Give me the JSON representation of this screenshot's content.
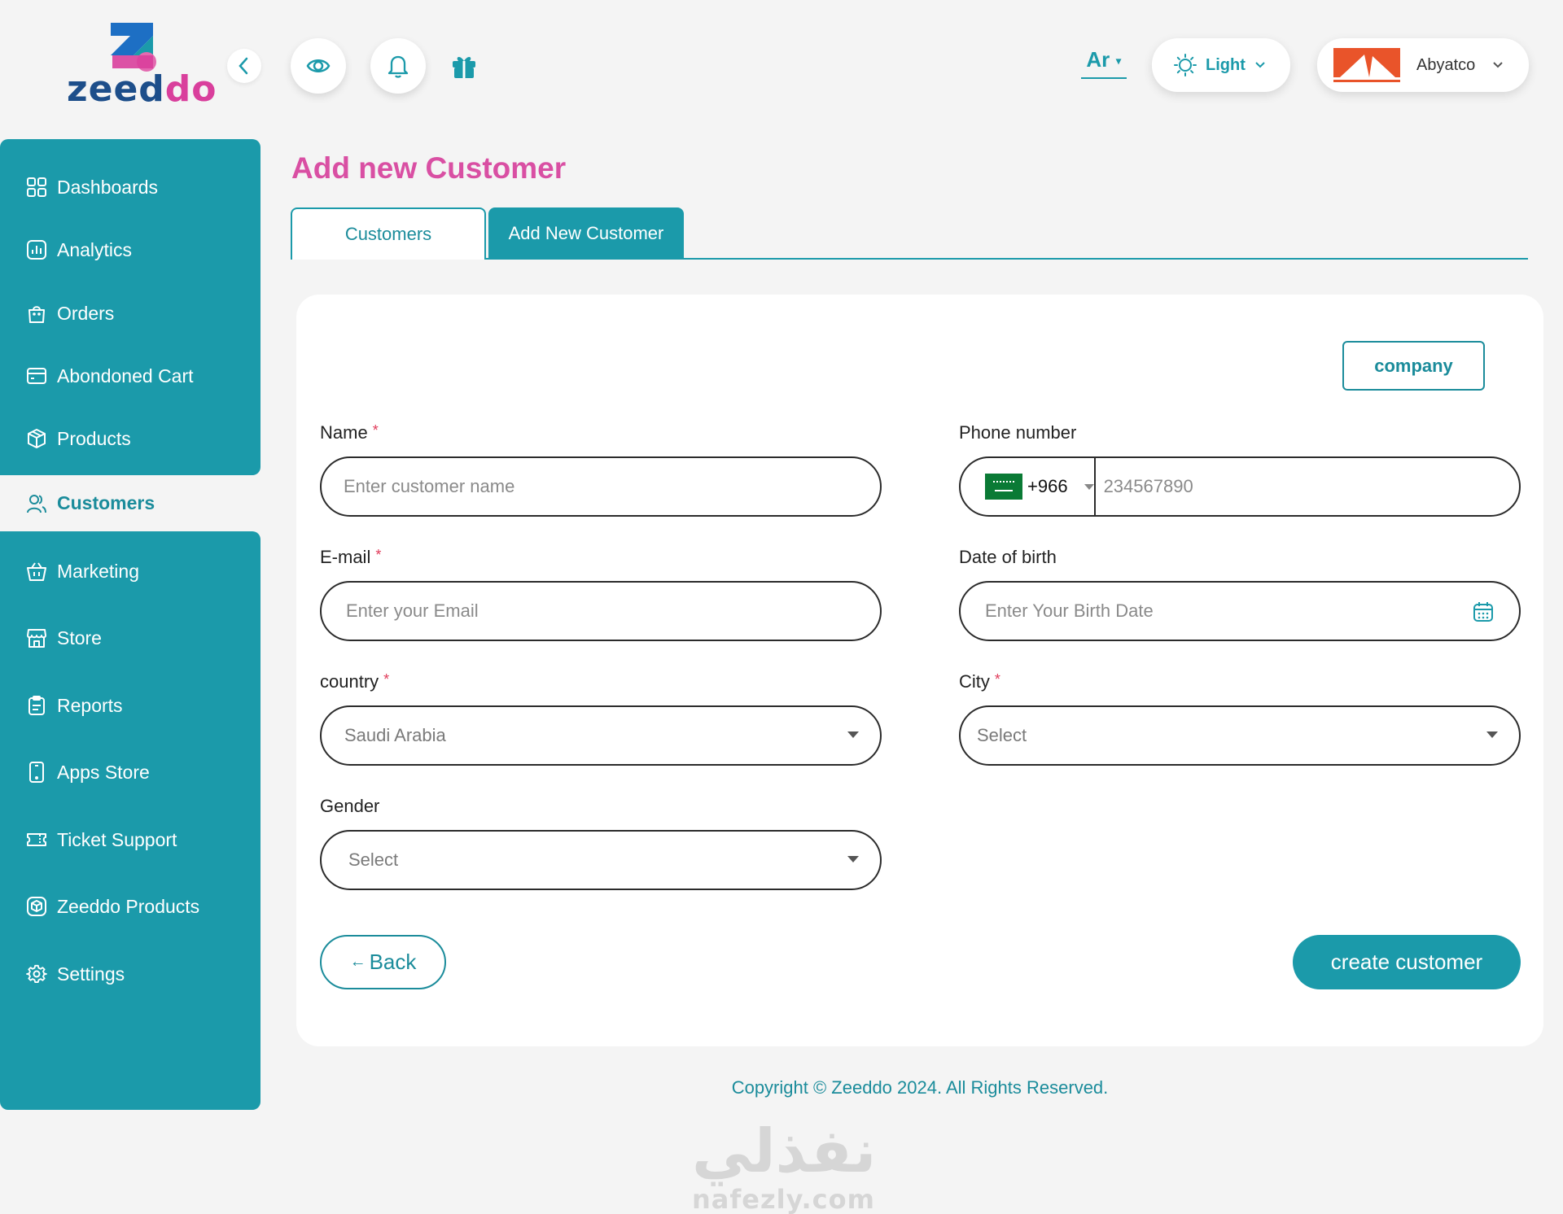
{
  "brand": {
    "name_part1": "zeed",
    "name_part2": "do"
  },
  "header": {
    "language": "Ar",
    "theme": "Light",
    "account": "Abyatco"
  },
  "sidebar": {
    "items": [
      {
        "label": "Dashboards",
        "icon": "grid-icon"
      },
      {
        "label": "Analytics",
        "icon": "analytics-icon"
      },
      {
        "label": "Orders",
        "icon": "bag-icon"
      },
      {
        "label": "Abondoned Cart",
        "icon": "cart-card-icon"
      },
      {
        "label": "Products",
        "icon": "box-icon"
      },
      {
        "label": "Customers",
        "icon": "users-icon",
        "active": true
      },
      {
        "label": "Marketing",
        "icon": "basket-icon"
      },
      {
        "label": "Store",
        "icon": "store-icon"
      },
      {
        "label": "Reports",
        "icon": "clipboard-icon"
      },
      {
        "label": "Apps Store",
        "icon": "phone-icon"
      },
      {
        "label": "Ticket Support",
        "icon": "ticket-icon"
      },
      {
        "label": "Zeeddo Products",
        "icon": "cube-icon"
      },
      {
        "label": "Settings",
        "icon": "gear-icon"
      }
    ]
  },
  "page": {
    "title": "Add new Customer",
    "tabs": [
      "Customers",
      "Add New Customer"
    ]
  },
  "form": {
    "company_label": "company",
    "name": {
      "label": "Name",
      "placeholder": "Enter customer name"
    },
    "phone": {
      "label": "Phone number",
      "code": "+966",
      "placeholder": "234567890"
    },
    "email": {
      "label": "E-mail",
      "placeholder": "Enter your Email"
    },
    "dob": {
      "label": "Date of birth",
      "placeholder": "Enter Your Birth Date"
    },
    "country": {
      "label": "country",
      "value": "Saudi Arabia"
    },
    "city": {
      "label": "City",
      "value": "Select"
    },
    "gender": {
      "label": "Gender",
      "value": "Select"
    },
    "required_mark": "*",
    "back_label": "Back",
    "back_arrow": "←",
    "create_label": "create customer"
  },
  "footer": {
    "copyright": "Copyright © Zeeddo 2024. All Rights Reserved."
  },
  "watermark": {
    "arabic": "نفذلي",
    "latin": "nafezly.com"
  },
  "colors": {
    "accent": "#1b9aaa",
    "title": "#d94fa3",
    "brand_blue": "#1d4e8a"
  }
}
